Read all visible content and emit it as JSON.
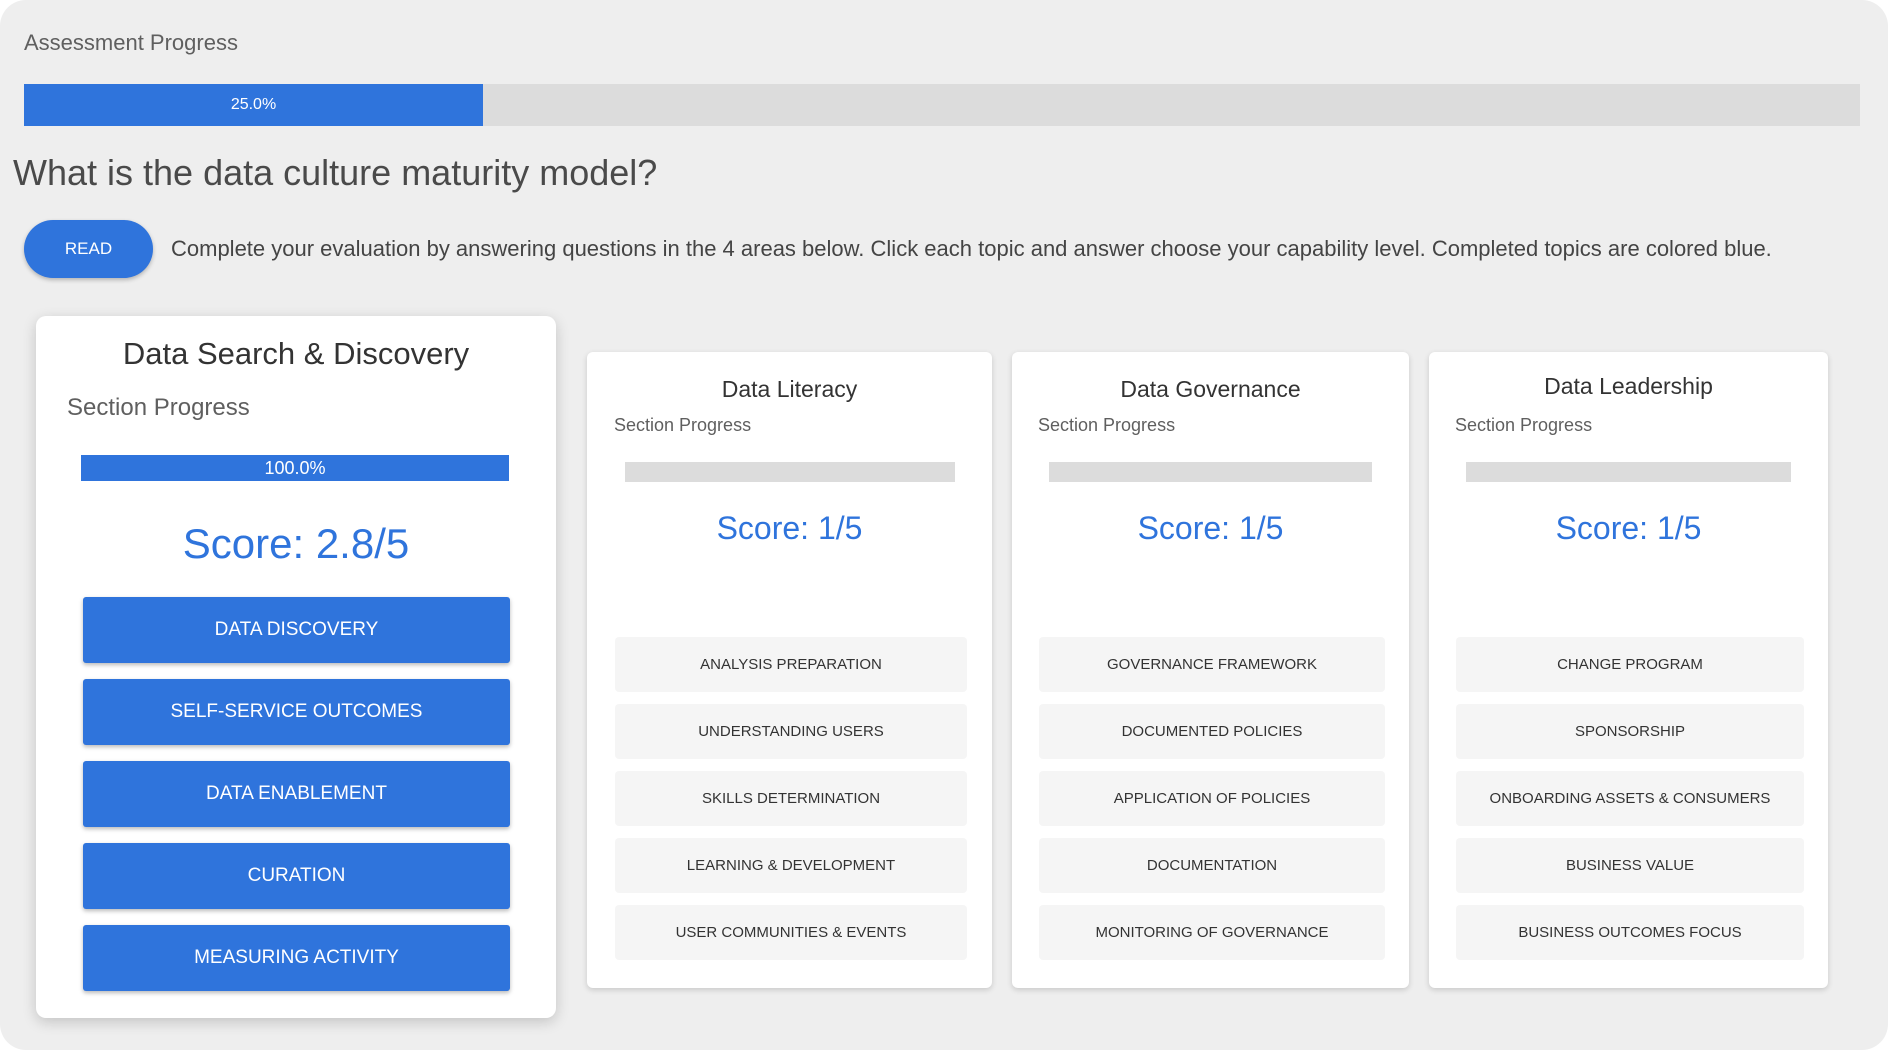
{
  "assessment": {
    "label": "Assessment Progress",
    "progress_percent": 25.0,
    "progress_text": "25.0%"
  },
  "question": "What is the data culture maturity model?",
  "read_button": "READ",
  "instructions": "Complete your evaluation by answering questions in the 4 areas below. Click each topic and answer choose your capability level. Completed topics are colored blue.",
  "section_progress_label": "Section Progress",
  "colors": {
    "accent": "#2f74dc",
    "track": "#dcdcdc",
    "background": "#eeeeee",
    "topic_incomplete": "#f5f5f5"
  },
  "sections": [
    {
      "title": "Data Search & Discovery",
      "progress_percent": 100.0,
      "progress_text": "100.0%",
      "score": "Score: 2.8/5",
      "topics": [
        "DATA DISCOVERY",
        "SELF-SERVICE OUTCOMES",
        "DATA ENABLEMENT",
        "CURATION",
        "MEASURING ACTIVITY"
      ]
    },
    {
      "title": "Data Literacy",
      "progress_percent": 0,
      "progress_text": "",
      "score": "Score: 1/5",
      "topics": [
        "ANALYSIS PREPARATION",
        "UNDERSTANDING USERS",
        "SKILLS DETERMINATION",
        "LEARNING & DEVELOPMENT",
        "USER COMMUNITIES & EVENTS"
      ]
    },
    {
      "title": "Data Governance",
      "progress_percent": 0,
      "progress_text": "",
      "score": "Score: 1/5",
      "topics": [
        "GOVERNANCE FRAMEWORK",
        "DOCUMENTED POLICIES",
        "APPLICATION OF POLICIES",
        "DOCUMENTATION",
        "MONITORING OF GOVERNANCE"
      ]
    },
    {
      "title": "Data Leadership",
      "progress_percent": 0,
      "progress_text": "",
      "score": "Score: 1/5",
      "topics": [
        "CHANGE PROGRAM",
        "SPONSORSHIP",
        "ONBOARDING ASSETS & CONSUMERS",
        "BUSINESS VALUE",
        "BUSINESS OUTCOMES FOCUS"
      ]
    }
  ]
}
